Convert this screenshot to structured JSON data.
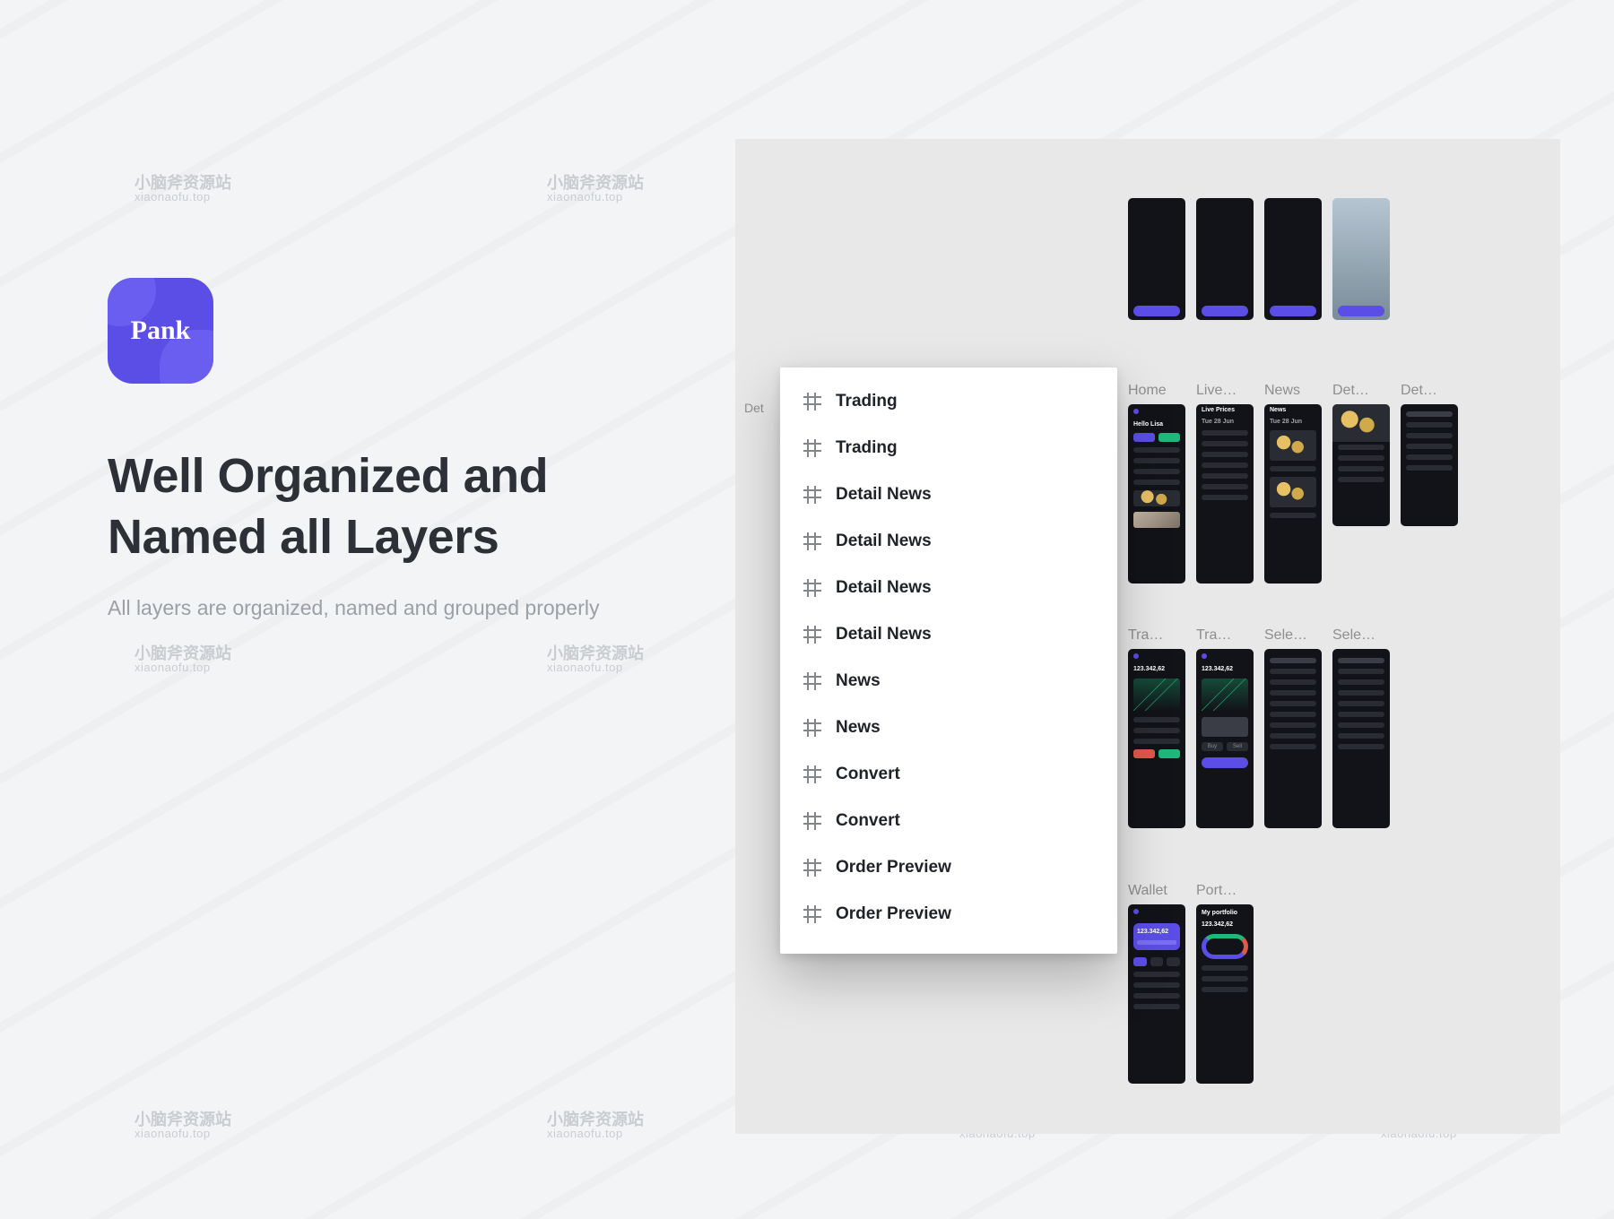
{
  "brand": {
    "name": "Pank"
  },
  "headline": "Well Organized and Named all Layers",
  "subline": "All layers are organized, named and grouped properly",
  "watermark": {
    "cn": "小脑斧资源站",
    "en": "xiaonaofu.top"
  },
  "canvas": {
    "partial_label": "Det",
    "layers": [
      "Trading",
      "Trading",
      "Detail News",
      "Detail News",
      "Detail News",
      "Detail News",
      "News",
      "News",
      "Convert",
      "Convert",
      "Order Preview",
      "Order Preview"
    ],
    "group2_caps": [
      "Home",
      "Live…",
      "News",
      "Det…",
      "Det…"
    ],
    "group3_caps": [
      "Tra…",
      "Tra…",
      "Sele…",
      "Sele…"
    ],
    "group4_caps": [
      "Wallet",
      "Port…"
    ],
    "price": "123.342,62",
    "screen_text": {
      "home_title": "Hello Lisa",
      "live_title": "Live Prices",
      "date": "Tue 28 Jun",
      "news_title": "News",
      "portfolio": "My portfolio",
      "buy": "Buy",
      "sell": "Sell"
    }
  }
}
